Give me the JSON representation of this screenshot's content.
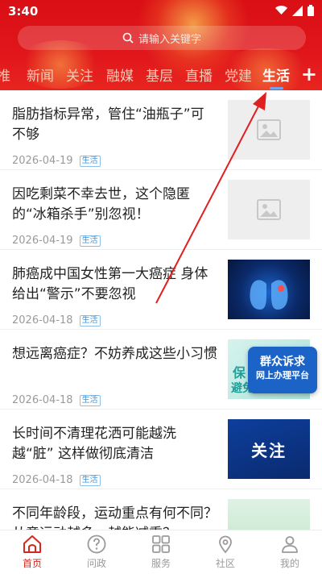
{
  "status_bar": {
    "time": "3:40"
  },
  "search": {
    "placeholder": "请输入关键字"
  },
  "tabs": [
    {
      "label": "推",
      "x": 0
    },
    {
      "label": "新闻"
    },
    {
      "label": "关注"
    },
    {
      "label": "融媒"
    },
    {
      "label": "基层"
    },
    {
      "label": "直播"
    },
    {
      "label": "党建"
    },
    {
      "label": "生活"
    }
  ],
  "news": [
    {
      "title": "脂肪指标异常，管住“油瓶子”可不够",
      "date": "2026-04-19",
      "tag": "生活"
    },
    {
      "title": "因吃剩菜不幸去世，这个隐匿的“冰箱杀手”别忽视！",
      "date": "2026-04-19",
      "tag": "生活"
    },
    {
      "title": "肺癌成中国女性第一大癌症  身体给出“警示”不要忽视",
      "date": "2026-04-18",
      "tag": "生活"
    },
    {
      "title": "想远离癌症？不妨养成这些小习惯",
      "date": "2026-04-18",
      "tag": "生活",
      "thumb_text_1": "保",
      "thumb_text_2": "避免"
    },
    {
      "title": "长时间不清理花洒可能越洗越“脏” 这样做彻底清洁",
      "date": "2026-04-18",
      "tag": "生活",
      "thumb_text": "关注"
    },
    {
      "title": "不同年龄段，运动重点有何不同？从童运动越多，越能减重？",
      "date": "",
      "tag": ""
    }
  ],
  "floating": {
    "line1": "群众诉求",
    "line2": "网上办理平台"
  },
  "bottom_nav": [
    {
      "label": "首页"
    },
    {
      "label": "问政"
    },
    {
      "label": "服务"
    },
    {
      "label": "社区"
    },
    {
      "label": "我的"
    }
  ],
  "colors": {
    "brand_red": "#d90f15",
    "active_nav": "#d7281e",
    "tag_blue": "#3f93d8",
    "annotation": "#e02020"
  }
}
